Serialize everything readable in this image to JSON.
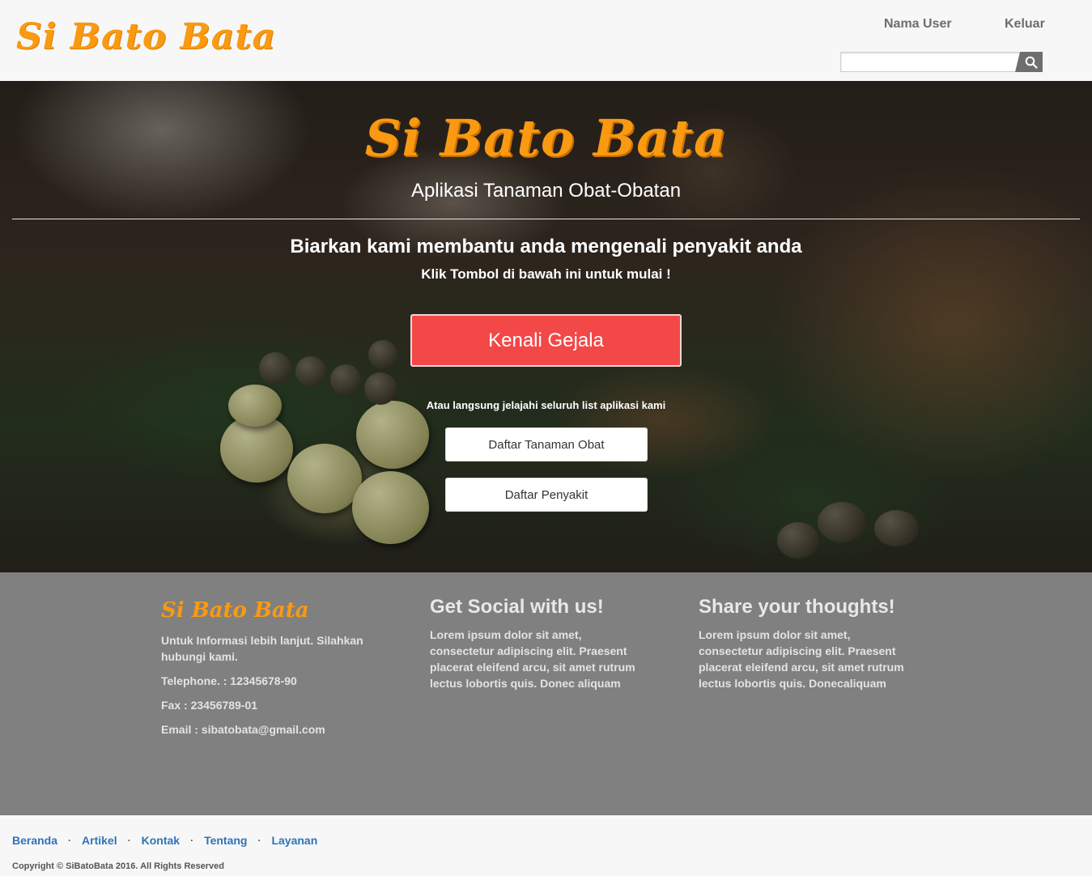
{
  "header": {
    "brand": "Si Bato Bata",
    "user_label": "Nama User",
    "logout_label": "Keluar",
    "search_placeholder": "",
    "search_icon": "search-icon"
  },
  "hero": {
    "title": "Si Bato Bata",
    "subtitle": "Aplikasi Tanaman Obat-Obatan",
    "lead": "Biarkan kami membantu anda mengenali penyakit anda",
    "cta_hint": "Klik Tombol di bawah ini untuk mulai !",
    "cta_label": "Kenali Gejala",
    "explore_text": "Atau langsung jelajahi seluruh list aplikasi kami",
    "list_buttons": [
      "Daftar Tanaman Obat",
      "Daftar Penyakit"
    ]
  },
  "footer": {
    "brand": "Si Bato Bata",
    "info_text": "Untuk Informasi lebih lanjut. Silahkan hubungi kami.",
    "telephone": "Telephone. : 12345678-90",
    "fax": "Fax : 23456789-01",
    "email": "Email : sibatobata@gmail.com",
    "social_heading": "Get Social with us!",
    "social_text": "Lorem ipsum dolor sit amet, consectetur adipiscing elit. Praesent placerat eleifend arcu, sit amet rutrum lectus lobortis quis. Donec aliquam",
    "thoughts_heading": "Share your thoughts!",
    "thoughts_text": "Lorem ipsum dolor sit amet, consectetur adipiscing elit. Praesent placerat eleifend arcu, sit amet rutrum lectus lobortis quis. Donecaliquam"
  },
  "bottom": {
    "links": [
      "Beranda",
      "Artikel",
      "Kontak",
      "Tentang",
      "Layanan"
    ],
    "separator": "·",
    "copyright": "Copyright © SiBatoBata 2016. All Rights Reserved"
  },
  "colors": {
    "brand_orange": "#f99a12",
    "cta_red": "#f34848",
    "footer_gray": "#808080",
    "link_blue": "#2f73b8"
  }
}
